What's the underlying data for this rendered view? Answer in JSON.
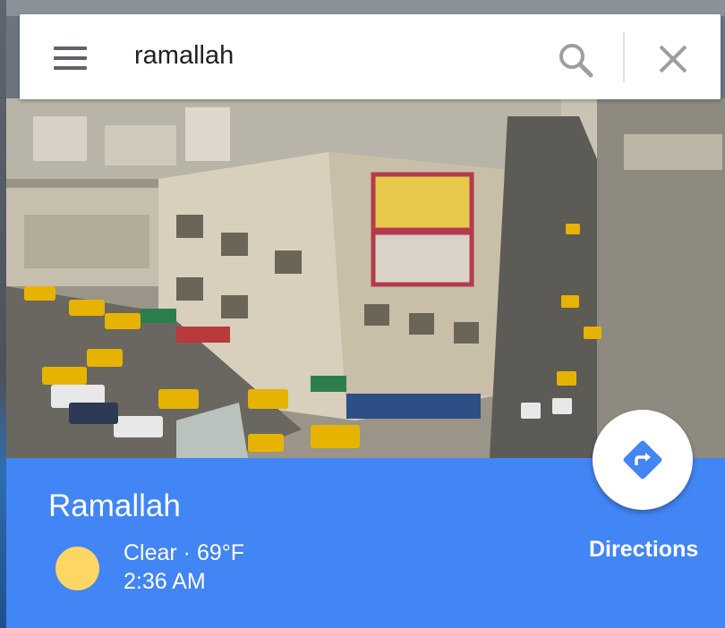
{
  "search": {
    "query": "ramallah",
    "menu_icon": "hamburger-menu-icon",
    "search_icon": "magnifier-icon",
    "close_icon": "close-x-icon"
  },
  "place": {
    "name": "Ramallah",
    "photo_icon": "city-street-photo"
  },
  "weather": {
    "icon": "sun-icon",
    "summary": "Clear · 69°F",
    "time": "2:36 AM"
  },
  "directions": {
    "label": "Directions",
    "icon": "directions-diamond-icon"
  },
  "colors": {
    "panel": "#4285f4",
    "sun": "#fdd663",
    "icon_grey": "#5f6368"
  }
}
